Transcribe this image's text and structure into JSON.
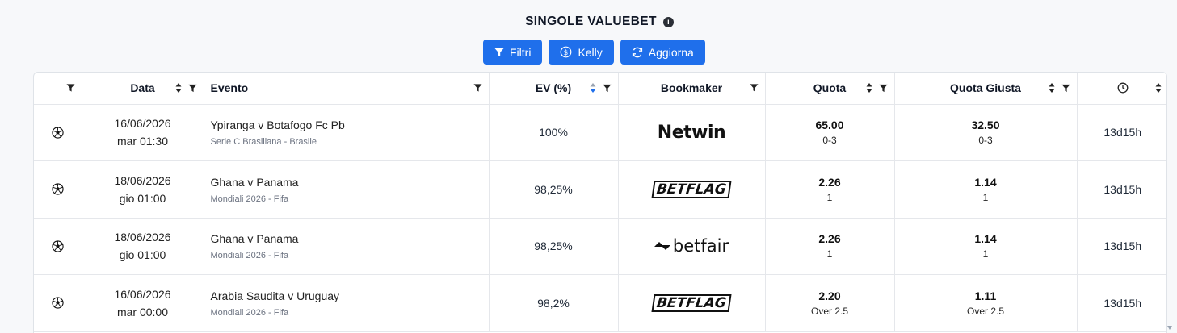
{
  "page": {
    "title": "SINGOLE VALUEBET",
    "buttons": {
      "filters": "Filtri",
      "kelly": "Kelly",
      "refresh": "Aggiorna"
    }
  },
  "colors": {
    "primary": "#1f6feb",
    "sort_active": "#1f6feb"
  },
  "table": {
    "headers": {
      "data": "Data",
      "evento": "Evento",
      "ev": "EV (%)",
      "bookmaker": "Bookmaker",
      "quota": "Quota",
      "quota_giusta": "Quota Giusta"
    },
    "rows": [
      {
        "sport_icon": "soccer-ball-icon",
        "date": "16/06/2026",
        "time": "mar 01:30",
        "event": "Ypiranga v Botafogo Fc Pb",
        "league": "Serie C Brasiliana - Brasile",
        "ev": "100%",
        "bookmaker": "Netwin",
        "bookmaker_logo": "netwin",
        "quota": "65.00",
        "quota_market": "0-3",
        "fair_quota": "32.50",
        "fair_market": "0-3",
        "time_left": "13d15h"
      },
      {
        "sport_icon": "soccer-ball-icon",
        "date": "18/06/2026",
        "time": "gio 01:00",
        "event": "Ghana v Panama",
        "league": "Mondiali 2026 - Fifa",
        "ev": "98,25%",
        "bookmaker": "BETFLAG",
        "bookmaker_logo": "betflag",
        "quota": "2.26",
        "quota_market": "1",
        "fair_quota": "1.14",
        "fair_market": "1",
        "time_left": "13d15h"
      },
      {
        "sport_icon": "soccer-ball-icon",
        "date": "18/06/2026",
        "time": "gio 01:00",
        "event": "Ghana v Panama",
        "league": "Mondiali 2026 - Fifa",
        "ev": "98,25%",
        "bookmaker": "betfair",
        "bookmaker_logo": "betfair",
        "quota": "2.26",
        "quota_market": "1",
        "fair_quota": "1.14",
        "fair_market": "1",
        "time_left": "13d15h"
      },
      {
        "sport_icon": "soccer-ball-icon",
        "date": "16/06/2026",
        "time": "mar 00:00",
        "event": "Arabia Saudita v Uruguay",
        "league": "Mondiali 2026 - Fifa",
        "ev": "98,2%",
        "bookmaker": "BETFLAG",
        "bookmaker_logo": "betflag",
        "quota": "2.20",
        "quota_market": "Over 2.5",
        "fair_quota": "1.11",
        "fair_market": "Over 2.5",
        "time_left": "13d15h"
      }
    ]
  }
}
